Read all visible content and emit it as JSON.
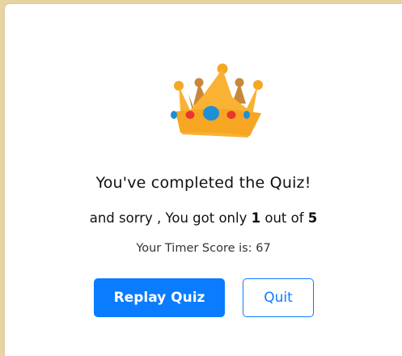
{
  "result": {
    "icon": "crown-icon",
    "title": "You've completed the Quiz!",
    "message_prefix": "and sorry , You got only",
    "correct_count": "1",
    "message_middle": "out of",
    "total_count": "5",
    "timer_label": "Your Timer Score is:",
    "timer_value": "67"
  },
  "actions": {
    "replay_label": "Replay Quiz",
    "quit_label": "Quit"
  },
  "colors": {
    "accent": "#0a7cff",
    "page_background": "#e8d3a3",
    "crown_gold": "#f9b233",
    "crown_gem_blue": "#1e90d6",
    "crown_gem_red": "#e8362e"
  }
}
